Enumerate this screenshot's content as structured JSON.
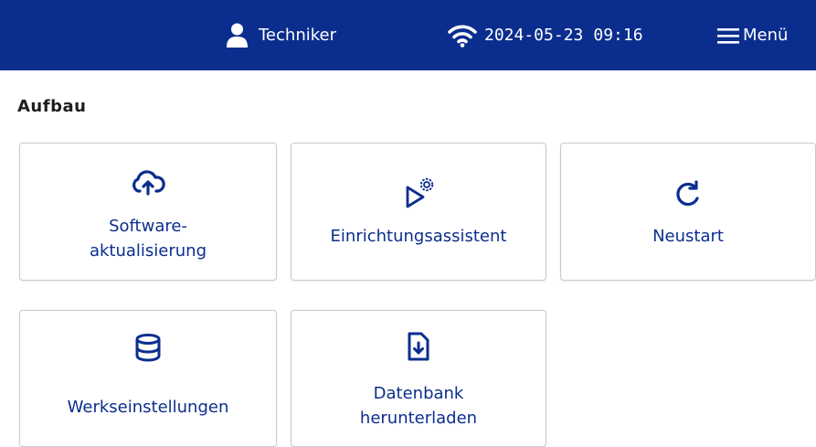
{
  "header": {
    "user_name": "Techniker",
    "date": "2024-05-23",
    "time": "09:16",
    "menu_label": "Menü",
    "icons": [
      "user-icon",
      "wifi-icon",
      "hamburger-menu-icon"
    ]
  },
  "section": {
    "title": "Aufbau"
  },
  "tiles": [
    {
      "label": "Software-\naktualisierung",
      "icon": "cloud-upload-icon"
    },
    {
      "label": "Einrichtungsassistent",
      "icon": "play-gear-icon"
    },
    {
      "label": "Neustart",
      "icon": "refresh-icon"
    },
    {
      "label": "Werkseinstellungen",
      "icon": "database-icon"
    },
    {
      "label": "Datenbank\nherunterladen",
      "icon": "file-download-icon"
    }
  ],
  "colors": {
    "header_bg": "#0b2e8e",
    "accent": "#0b2e8e",
    "header_text": "#ffffff",
    "tile_border": "#c9c9c9"
  }
}
